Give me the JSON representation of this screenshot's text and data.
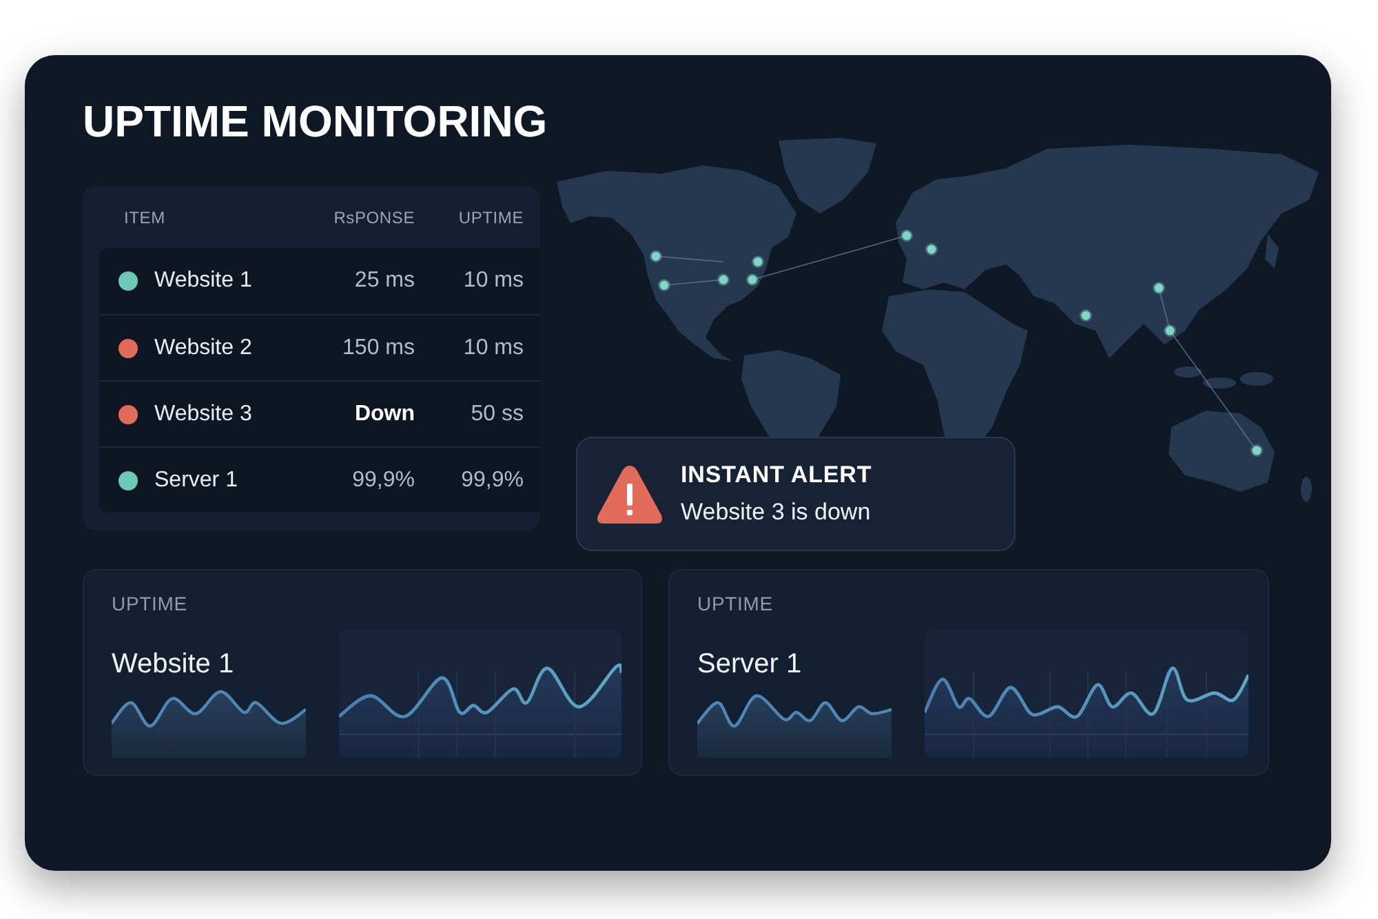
{
  "title": "UPTIME MONITORING",
  "table": {
    "columns": [
      "ITEM",
      "RsPONSE",
      "UPTIME"
    ],
    "rows": [
      {
        "item": "Website 1",
        "color": "#6cc9b5",
        "response": "25 ms",
        "response_highlighted": false,
        "uptime": "10 ms"
      },
      {
        "item": "Website 2",
        "color": "#e26b5a",
        "response": "150 ms",
        "response_highlighted": false,
        "uptime": "10 ms"
      },
      {
        "item": "Website 3",
        "color": "#e26b5a",
        "response": "Down",
        "response_highlighted": true,
        "uptime": "50 ss"
      },
      {
        "item": "Server 1",
        "color": "#6cc9b5",
        "response": "99,9%",
        "response_highlighted": false,
        "uptime": "99,9%"
      }
    ]
  },
  "alert": {
    "title": "INSTANT ALERT",
    "message": "Website 3 is down"
  },
  "cards": [
    {
      "label": "UPTIME",
      "name": "Website 1"
    },
    {
      "label": "UPTIME",
      "name": "Server 1"
    }
  ]
}
